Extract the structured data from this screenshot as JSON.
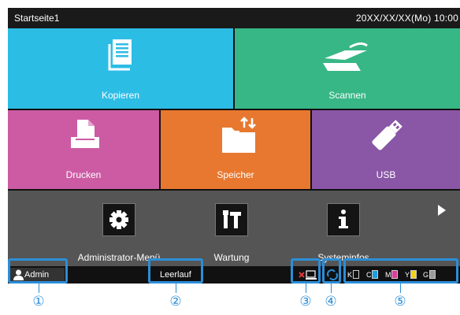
{
  "title_bar": {
    "screen_name": "Startseite1",
    "datetime": "20XX/XX/XX(Mo) 10:00"
  },
  "tiles": {
    "copy": "Kopieren",
    "scan": "Scannen",
    "print": "Drucken",
    "storage": "Speicher",
    "usb": "USB"
  },
  "tools": {
    "admin_menu": "Administrator-Menü",
    "maintenance": "Wartung",
    "system_info": "Systeminfos"
  },
  "status_bar": {
    "user": "Admin",
    "machine_state": "Leerlauf",
    "inks": [
      "K",
      "C",
      "M",
      "Y",
      "G"
    ]
  },
  "callouts": [
    "①",
    "②",
    "③",
    "④",
    "⑤"
  ],
  "colors": {
    "copy": "#2cbde5",
    "scan": "#37b786",
    "print": "#cc5ba4",
    "storage": "#e8782f",
    "usb": "#8a56a6",
    "highlight": "#2b8ed8",
    "ink_c": "#1aa0e0",
    "ink_m": "#d8409a",
    "ink_y": "#f2d21a",
    "ink_g": "#9a9a9a"
  },
  "icons": [
    "document-icon",
    "scanner-icon",
    "printer-icon",
    "folder-storage-icon",
    "usb-stick-icon",
    "gear-icon",
    "tools-icon",
    "info-icon",
    "chevron-right-icon",
    "user-icon",
    "network-icon",
    "refresh-icon"
  ]
}
